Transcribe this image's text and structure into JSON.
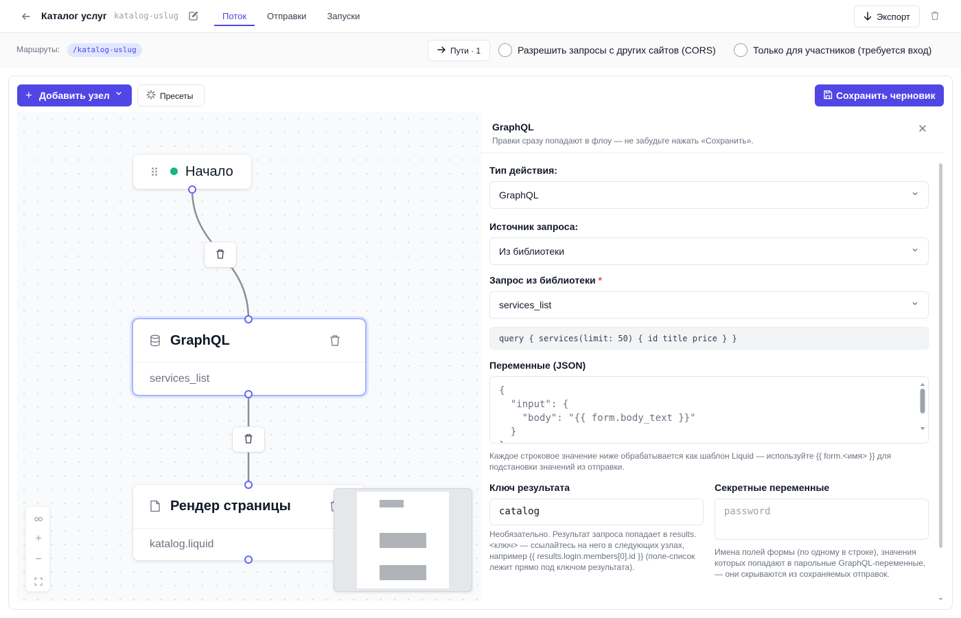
{
  "header": {
    "title": "Каталог услуг",
    "slug": "katalog-uslug",
    "tabs": [
      {
        "label": "Поток",
        "active": true
      },
      {
        "label": "Отправки",
        "active": false
      },
      {
        "label": "Запуски",
        "active": false
      }
    ],
    "export_label": "Экспорт"
  },
  "subbar": {
    "routes_label": "Маршруты:",
    "route": "/katalog-uslug",
    "paths_label": "Пути · 1",
    "cors_label": "Разрешить запросы с других сайтов (CORS)",
    "cors_checked": false,
    "members_label": "Только для участников (требуется вход)",
    "members_checked": false
  },
  "toolbar": {
    "add_node_label": "Добавить узел",
    "presets_label": "Пресеты",
    "save_label": "Сохранить черновик"
  },
  "canvas": {
    "start_node": {
      "label": "Начало",
      "status_color": "#10b981"
    },
    "graphql_node": {
      "title": "GraphQL",
      "subtitle": "services_list"
    },
    "render_node": {
      "title": "Рендер страницы",
      "subtitle": "katalog.liquid"
    }
  },
  "panel": {
    "title": "GraphQL",
    "subtitle": "Правки сразу попадают в флоу — не забудьте нажать «Сохранить».",
    "action_type_label": "Тип действия:",
    "action_type_value": "GraphQL",
    "source_label": "Источник запроса:",
    "source_value": "Из библиотеки",
    "query_label": "Запрос из библиотеки",
    "query_required": "*",
    "query_value": "services_list",
    "query_preview": "query { services(limit: 50) { id title price } }",
    "variables_label": "Переменные (JSON)",
    "variables_value": "{\n  \"input\": {\n    \"body\": \"{{ form.body_text }}\"\n  }\n}",
    "variables_hint": "Каждое строковое значение ниже обрабатывается как шаблон Liquid — используйте {{ form.<имя> }} для подстановки значений из отправки.",
    "result_key_label": "Ключ результата",
    "result_key_value": "catalog",
    "result_key_hint": "Необязательно. Результат запроса попадает в results.<ключ> — ссылайтесь на него в следующих узлах, например {{ results.login.members[0].id }} (поле-список лежит прямо под ключом результата).",
    "secret_label": "Секретные переменные",
    "secret_placeholder": "password",
    "secret_hint": "Имена полей формы (по одному в строке), значения которых попадают в парольные GraphQL-переменные, — они скрываются из сохраняемых отправок."
  },
  "colors": {
    "accent": "#4f46e5",
    "accent_light": "#e0e7ff",
    "required": "#ef4444"
  }
}
